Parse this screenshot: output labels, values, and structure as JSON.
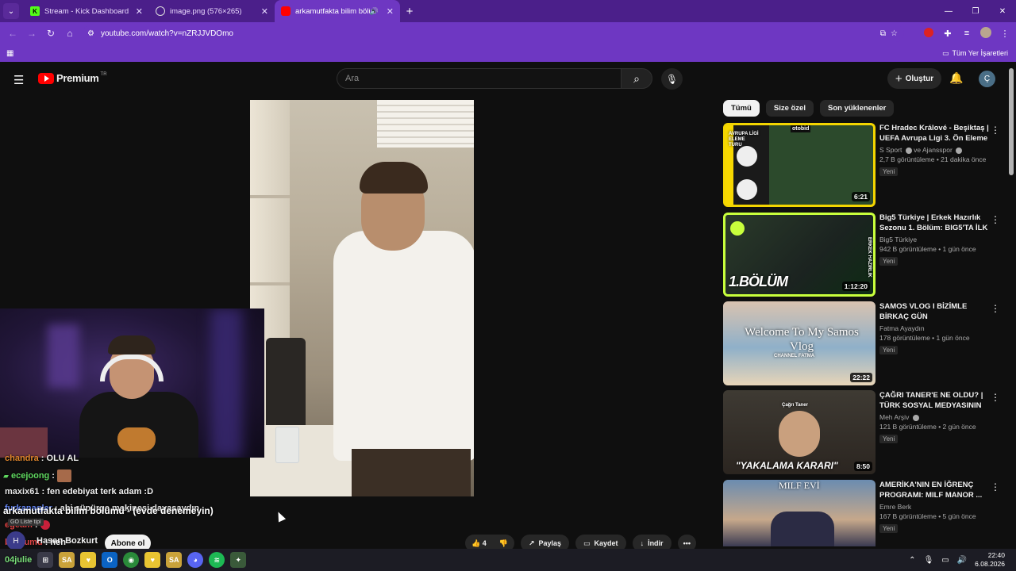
{
  "browser": {
    "tabs": [
      {
        "label": "Stream - Kick Dashboard",
        "favicon": "K",
        "active": false
      },
      {
        "label": "image.png (576×265)",
        "favicon": "",
        "active": false
      },
      {
        "label": "arkamutfakta bilim bölüm",
        "favicon": "",
        "active": true
      }
    ],
    "url": "youtube.com/watch?v=nZRJJVDOmo",
    "bookmarks_all": "Tüm Yer İşaretleri"
  },
  "yt": {
    "logo_text": "Premium",
    "logo_sup": "TR",
    "search_placeholder": "Ara",
    "create_label": "Oluştur",
    "avatar_letter": "Ç"
  },
  "video": {
    "channel_name": "Hasan Bozkurt",
    "subscribe_label": "Abone ol",
    "likes": "4",
    "share_label": "Paylaş",
    "save_label": "Kaydet",
    "download_label": "İndir",
    "caption": "arkamutfakta bilim bölümü - (evde denemeyin)",
    "go_tip": "GO Liste tipi"
  },
  "chat": [
    {
      "name": "chandra",
      "text": ": OLU AL",
      "color": "#e1862c"
    },
    {
      "name": "ecejoong",
      "text": ":",
      "color": "#5fd85f",
      "emote": true
    },
    {
      "name": "maxix61",
      "text": ": fen edebiyat terk adam :D",
      "color": "#e6e6e6"
    },
    {
      "name": "furkanagler",
      "text": ": abi süpürge makinesi dayasaydın",
      "color": "#6a8cff"
    },
    {
      "name": "egeam",
      "text": ":",
      "color": "#e04444",
      "emote_small": true
    },
    {
      "name": "burdumu",
      "text": ": heh",
      "color": "#e04444"
    },
    {
      "name": "04julie",
      "text": ":",
      "color": "#7ae07a"
    }
  ],
  "sidebar": {
    "chips": [
      "Tümü",
      "Size özel",
      "Son yüklenenler"
    ],
    "items": [
      {
        "title": "FC Hradec Králové - Beşiktaş | UEFA Avrupa Ligi 3. Ön Eleme ...",
        "channel": "S Sport",
        "channel_extra": "ve Ajansspor",
        "stats": "2,7 B görüntüleme • 21 dakika önce",
        "badge": "Yeni",
        "duration": "6:21"
      },
      {
        "title": "Big5 Türkiye | Erkek Hazırlık Sezonu 1. Bölüm: BIG5'TA İLK ...",
        "channel": "Big5 Türkiye",
        "channel_extra": "",
        "stats": "942 B görüntüleme • 1 gün önce",
        "badge": "Yeni",
        "duration": "1:12:20"
      },
      {
        "title": "SAMOS VLOG I BİZİMLE BİRKAÇ GÜN",
        "channel": "Fatma Ayaydın",
        "channel_extra": "",
        "stats": "178 görüntüleme • 1 gün önce",
        "badge": "Yeni",
        "duration": "22:22"
      },
      {
        "title": "ÇAĞRI TANER'E NE OLDU? | TÜRK SOSYAL MEDYASININ ...",
        "channel": "Meh Arşiv",
        "channel_extra": "",
        "stats": "121 B görüntüleme • 2 gün önce",
        "badge": "Yeni",
        "duration": "8:50"
      },
      {
        "title": "AMERİKA'NIN EN İĞRENÇ PROGRAMI: MILF MANOR ...",
        "channel": "Emre Berk",
        "channel_extra": "",
        "stats": "167 B görüntüleme • 5 gün önce",
        "badge": "Yeni",
        "duration": ""
      }
    ],
    "thumb_texts": {
      "t1_tag": "otobid",
      "t1_caption": "AVRUPA LİGİ ELEME TURU",
      "t2_caption": "1.BÖLÜM",
      "t2_side": "ERKEK HAZIRLIK",
      "t3_caption": "Welcome To My Samos Vlog",
      "t3_sub": "CHANNEL FATMA",
      "t4_caption": "\"YAKALAMA KARARI\"",
      "t4_sign": "Çağrı Taner",
      "t5_caption": "MILF EVİ"
    }
  },
  "taskbar": {
    "time": "22:40",
    "date": "6.08.2026"
  }
}
